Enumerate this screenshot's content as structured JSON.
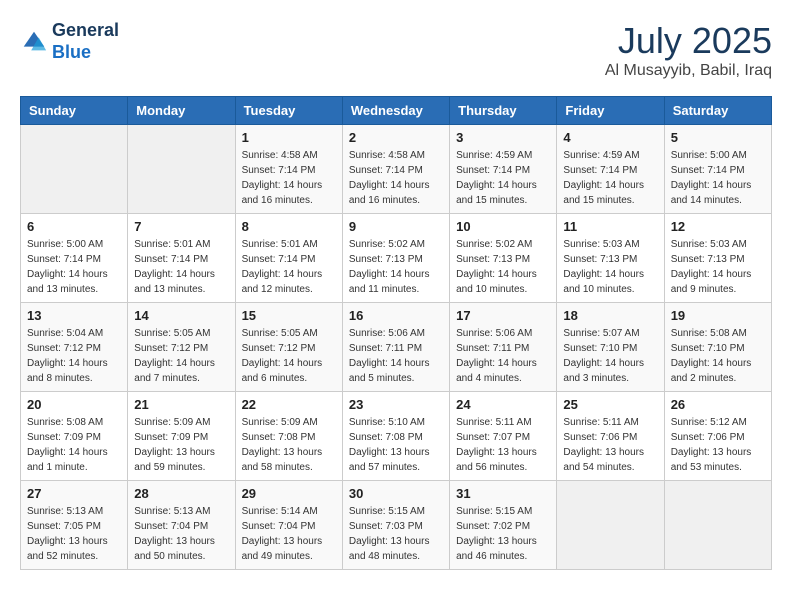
{
  "header": {
    "logo_line1": "General",
    "logo_line2": "Blue",
    "month": "July 2025",
    "location": "Al Musayyib, Babil, Iraq"
  },
  "weekdays": [
    "Sunday",
    "Monday",
    "Tuesday",
    "Wednesday",
    "Thursday",
    "Friday",
    "Saturday"
  ],
  "weeks": [
    [
      {
        "day": "",
        "info": ""
      },
      {
        "day": "",
        "info": ""
      },
      {
        "day": "1",
        "info": "Sunrise: 4:58 AM\nSunset: 7:14 PM\nDaylight: 14 hours and 16 minutes."
      },
      {
        "day": "2",
        "info": "Sunrise: 4:58 AM\nSunset: 7:14 PM\nDaylight: 14 hours and 16 minutes."
      },
      {
        "day": "3",
        "info": "Sunrise: 4:59 AM\nSunset: 7:14 PM\nDaylight: 14 hours and 15 minutes."
      },
      {
        "day": "4",
        "info": "Sunrise: 4:59 AM\nSunset: 7:14 PM\nDaylight: 14 hours and 15 minutes."
      },
      {
        "day": "5",
        "info": "Sunrise: 5:00 AM\nSunset: 7:14 PM\nDaylight: 14 hours and 14 minutes."
      }
    ],
    [
      {
        "day": "6",
        "info": "Sunrise: 5:00 AM\nSunset: 7:14 PM\nDaylight: 14 hours and 13 minutes."
      },
      {
        "day": "7",
        "info": "Sunrise: 5:01 AM\nSunset: 7:14 PM\nDaylight: 14 hours and 13 minutes."
      },
      {
        "day": "8",
        "info": "Sunrise: 5:01 AM\nSunset: 7:14 PM\nDaylight: 14 hours and 12 minutes."
      },
      {
        "day": "9",
        "info": "Sunrise: 5:02 AM\nSunset: 7:13 PM\nDaylight: 14 hours and 11 minutes."
      },
      {
        "day": "10",
        "info": "Sunrise: 5:02 AM\nSunset: 7:13 PM\nDaylight: 14 hours and 10 minutes."
      },
      {
        "day": "11",
        "info": "Sunrise: 5:03 AM\nSunset: 7:13 PM\nDaylight: 14 hours and 10 minutes."
      },
      {
        "day": "12",
        "info": "Sunrise: 5:03 AM\nSunset: 7:13 PM\nDaylight: 14 hours and 9 minutes."
      }
    ],
    [
      {
        "day": "13",
        "info": "Sunrise: 5:04 AM\nSunset: 7:12 PM\nDaylight: 14 hours and 8 minutes."
      },
      {
        "day": "14",
        "info": "Sunrise: 5:05 AM\nSunset: 7:12 PM\nDaylight: 14 hours and 7 minutes."
      },
      {
        "day": "15",
        "info": "Sunrise: 5:05 AM\nSunset: 7:12 PM\nDaylight: 14 hours and 6 minutes."
      },
      {
        "day": "16",
        "info": "Sunrise: 5:06 AM\nSunset: 7:11 PM\nDaylight: 14 hours and 5 minutes."
      },
      {
        "day": "17",
        "info": "Sunrise: 5:06 AM\nSunset: 7:11 PM\nDaylight: 14 hours and 4 minutes."
      },
      {
        "day": "18",
        "info": "Sunrise: 5:07 AM\nSunset: 7:10 PM\nDaylight: 14 hours and 3 minutes."
      },
      {
        "day": "19",
        "info": "Sunrise: 5:08 AM\nSunset: 7:10 PM\nDaylight: 14 hours and 2 minutes."
      }
    ],
    [
      {
        "day": "20",
        "info": "Sunrise: 5:08 AM\nSunset: 7:09 PM\nDaylight: 14 hours and 1 minute."
      },
      {
        "day": "21",
        "info": "Sunrise: 5:09 AM\nSunset: 7:09 PM\nDaylight: 13 hours and 59 minutes."
      },
      {
        "day": "22",
        "info": "Sunrise: 5:09 AM\nSunset: 7:08 PM\nDaylight: 13 hours and 58 minutes."
      },
      {
        "day": "23",
        "info": "Sunrise: 5:10 AM\nSunset: 7:08 PM\nDaylight: 13 hours and 57 minutes."
      },
      {
        "day": "24",
        "info": "Sunrise: 5:11 AM\nSunset: 7:07 PM\nDaylight: 13 hours and 56 minutes."
      },
      {
        "day": "25",
        "info": "Sunrise: 5:11 AM\nSunset: 7:06 PM\nDaylight: 13 hours and 54 minutes."
      },
      {
        "day": "26",
        "info": "Sunrise: 5:12 AM\nSunset: 7:06 PM\nDaylight: 13 hours and 53 minutes."
      }
    ],
    [
      {
        "day": "27",
        "info": "Sunrise: 5:13 AM\nSunset: 7:05 PM\nDaylight: 13 hours and 52 minutes."
      },
      {
        "day": "28",
        "info": "Sunrise: 5:13 AM\nSunset: 7:04 PM\nDaylight: 13 hours and 50 minutes."
      },
      {
        "day": "29",
        "info": "Sunrise: 5:14 AM\nSunset: 7:04 PM\nDaylight: 13 hours and 49 minutes."
      },
      {
        "day": "30",
        "info": "Sunrise: 5:15 AM\nSunset: 7:03 PM\nDaylight: 13 hours and 48 minutes."
      },
      {
        "day": "31",
        "info": "Sunrise: 5:15 AM\nSunset: 7:02 PM\nDaylight: 13 hours and 46 minutes."
      },
      {
        "day": "",
        "info": ""
      },
      {
        "day": "",
        "info": ""
      }
    ]
  ]
}
